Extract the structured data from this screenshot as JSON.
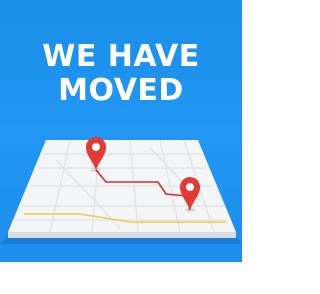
{
  "headline": {
    "line1": "WE HAVE",
    "line2": "MOVED"
  },
  "colors": {
    "background": "#1f93ee",
    "text": "#ffffff",
    "pin": "#e53935",
    "route": "#d32f2f",
    "map_surface": "#f4f5f7",
    "map_roads": "#e2e4e8",
    "map_highlight_road": "#f2c94c"
  },
  "icons": {
    "origin_pin": "map-pin-icon",
    "destination_pin": "map-pin-icon"
  }
}
